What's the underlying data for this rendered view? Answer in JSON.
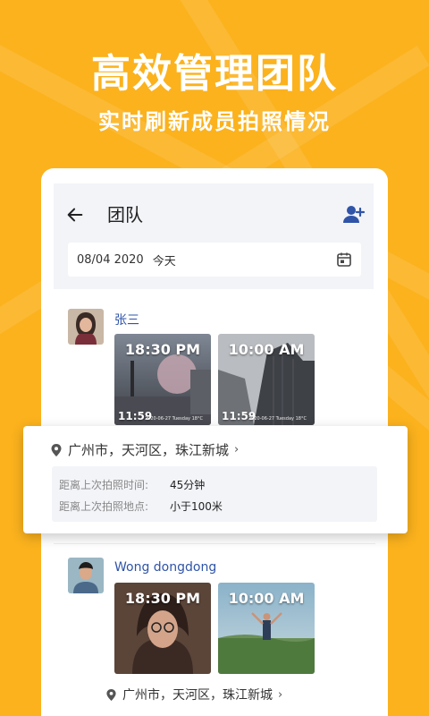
{
  "hero": {
    "title": "高效管理团队",
    "subtitle": "实时刷新成员拍照情况"
  },
  "header": {
    "title": "团队",
    "back_icon": "arrow-left-icon",
    "add_icon": "add-user-icon"
  },
  "date_filter": {
    "date": "08/04 2020",
    "label": "今天",
    "icon": "calendar-icon"
  },
  "members": [
    {
      "name": "张三",
      "photos": [
        {
          "time": "18:30 PM",
          "stamp": "11:59",
          "stamp_sub": "2020-06-27 Tuesday 18°C"
        },
        {
          "time": "10:00 AM",
          "stamp": "11:59",
          "stamp_sub": "2020-06-27 Tuesday 18°C"
        }
      ],
      "location": "广州市，天河区，珠江新城"
    },
    {
      "name": "Wong dongdong",
      "photos": [
        {
          "time": "18:30 PM"
        },
        {
          "time": "10:00 AM"
        }
      ],
      "location": "广州市，天河区，珠江新城"
    }
  ],
  "popup": {
    "location": "广州市，天河区，珠江新城",
    "rows": [
      {
        "label": "距离上次拍照时间:",
        "value": "45分钟"
      },
      {
        "label": "距离上次拍照地点:",
        "value": "小于100米"
      }
    ]
  },
  "colors": {
    "background": "#FBB21D",
    "accent": "#2F54A8",
    "panel": "#F3F4F8"
  }
}
